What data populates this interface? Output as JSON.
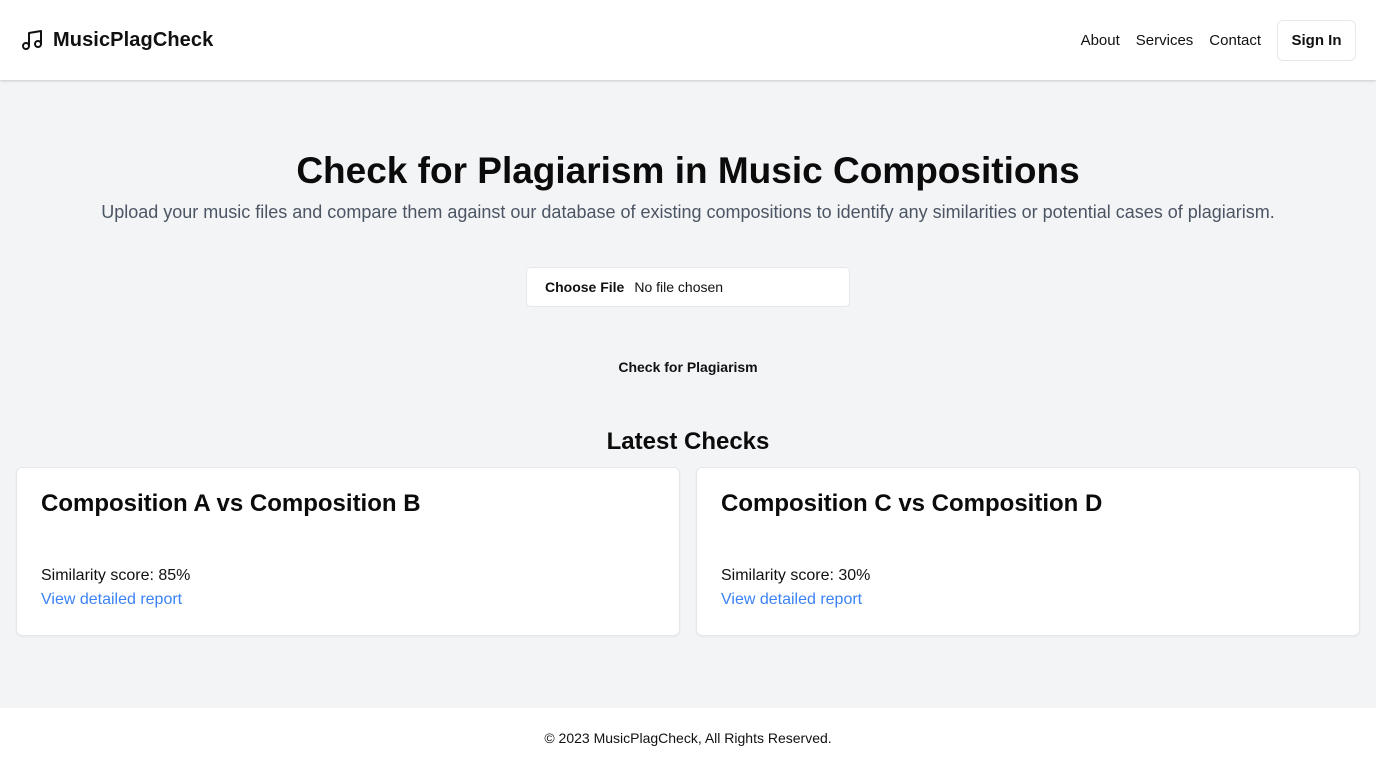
{
  "header": {
    "brand": "MusicPlagCheck",
    "brand_icon": "music-note-icon",
    "nav": [
      "About",
      "Services",
      "Contact"
    ],
    "signin_label": "Sign In"
  },
  "hero": {
    "title": "Check for Plagiarism in Music Compositions",
    "subtitle": "Upload your music files and compare them against our database of existing compositions to identify any similarities or potential cases of plagiarism."
  },
  "upload": {
    "choose_label": "Choose File",
    "status": "No file chosen",
    "submit_label": "Check for Plagiarism"
  },
  "latest": {
    "heading": "Latest Checks",
    "cards": [
      {
        "title": "Composition A vs Composition B",
        "score": "Similarity score: 85%",
        "link": "View detailed report"
      },
      {
        "title": "Composition C vs Composition D",
        "score": "Similarity score: 30%",
        "link": "View detailed report"
      }
    ]
  },
  "footer": {
    "text": "© 2023 MusicPlagCheck, All Rights Reserved."
  },
  "colors": {
    "link": "#3b82f6",
    "background": "#f3f4f6",
    "subtitle": "#4b5563"
  }
}
